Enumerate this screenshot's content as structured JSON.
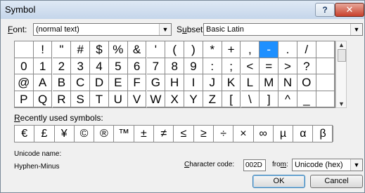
{
  "window": {
    "title": "Symbol",
    "help_label": "?",
    "close_label": "✕"
  },
  "font": {
    "label_pre": "",
    "label_ul": "F",
    "label_post": "ont:",
    "value": "(normal text)"
  },
  "subset": {
    "label_pre": "S",
    "label_ul": "u",
    "label_post": "bset:",
    "value": "Basic Latin"
  },
  "grid": {
    "rows": [
      [
        "",
        "!",
        "\"",
        "#",
        "$",
        "%",
        "&",
        "'",
        "(",
        ")",
        "*",
        "+",
        ",",
        "-",
        ".",
        "/",
        "",
        ""
      ],
      [
        "0",
        "1",
        "2",
        "3",
        "4",
        "5",
        "6",
        "7",
        "8",
        "9",
        ":",
        ";",
        "<",
        "=",
        ">",
        "?",
        "",
        ""
      ],
      [
        "@",
        "A",
        "B",
        "C",
        "D",
        "E",
        "F",
        "G",
        "H",
        "I",
        "J",
        "K",
        "L",
        "M",
        "N",
        "O",
        "",
        ""
      ],
      [
        "P",
        "Q",
        "R",
        "S",
        "T",
        "U",
        "V",
        "W",
        "X",
        "Y",
        "Z",
        "[",
        "\\",
        "]",
        "^",
        "_",
        "",
        ""
      ]
    ],
    "selected": {
      "row": 0,
      "col": 13
    }
  },
  "recent": {
    "label_pre": "",
    "label_ul": "R",
    "label_post": "ecently used symbols:",
    "symbols": [
      "€",
      "£",
      "¥",
      "©",
      "®",
      "™",
      "±",
      "≠",
      "≤",
      "≥",
      "÷",
      "×",
      "∞",
      "µ",
      "α",
      "β"
    ]
  },
  "unicode": {
    "name_label": "Unicode name:",
    "name_value": "Hyphen-Minus"
  },
  "charcode": {
    "label_pre": "",
    "label_ul": "C",
    "label_post": "haracter code:",
    "value": "002D"
  },
  "from": {
    "label_pre": "fro",
    "label_ul": "m",
    "label_post": ":",
    "value": "Unicode (hex)"
  },
  "buttons": {
    "ok": "OK",
    "cancel": "Cancel"
  }
}
